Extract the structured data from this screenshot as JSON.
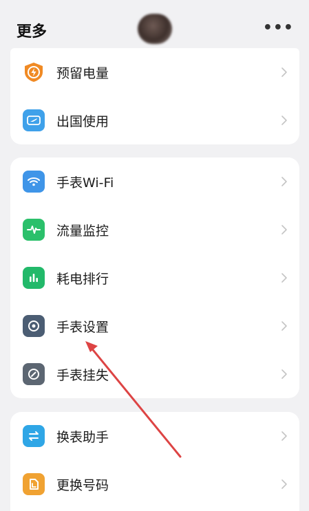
{
  "header": {
    "title": "更多",
    "more_label": "•••"
  },
  "colors": {
    "battery": "#f08a24",
    "travel": "#3fa1ea",
    "wifi": "#3f95e8",
    "traffic": "#2bc06b",
    "power": "#22b96a",
    "settings": "#4b5d73",
    "lost": "#5c6672",
    "switch": "#2fa6e6",
    "number": "#f0a232",
    "annotation_arrow": "#dd4444"
  },
  "cards": [
    {
      "items": [
        {
          "label": "预留电量",
          "icon": "battery-shield-icon"
        },
        {
          "label": "出国使用",
          "icon": "airplane-ticket-icon"
        }
      ]
    },
    {
      "items": [
        {
          "label": "手表Wi-Fi",
          "icon": "wifi-icon"
        },
        {
          "label": "流量监控",
          "icon": "pulse-icon"
        },
        {
          "label": "耗电排行",
          "icon": "bar-chart-icon"
        },
        {
          "label": "手表设置",
          "icon": "watch-settings-icon"
        },
        {
          "label": "手表挂失",
          "icon": "watch-lost-icon"
        }
      ]
    },
    {
      "items": [
        {
          "label": "换表助手",
          "icon": "swap-icon"
        },
        {
          "label": "更换号码",
          "icon": "sim-card-icon"
        }
      ]
    }
  ]
}
